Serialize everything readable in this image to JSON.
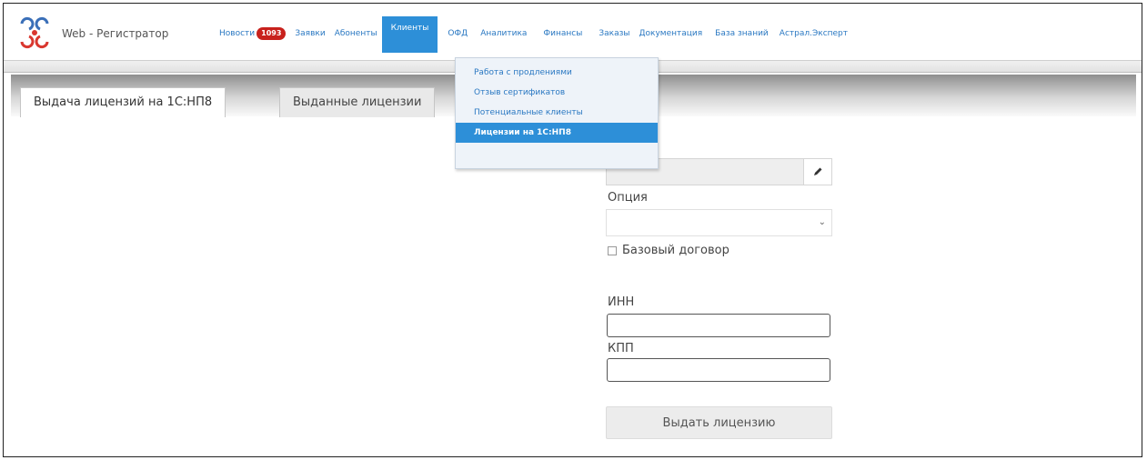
{
  "app": {
    "brand": "Web - Регистратор"
  },
  "nav": {
    "items": [
      {
        "label": "Новости",
        "badge": "1093"
      },
      {
        "label": "Заявки"
      },
      {
        "label": "Абоненты"
      },
      {
        "label": "Клиенты",
        "active": true
      },
      {
        "label": "ОФД"
      },
      {
        "label": "Аналитика"
      },
      {
        "label": "Финансы"
      },
      {
        "label": "Заказы"
      },
      {
        "label": "Документация"
      },
      {
        "label": "База знаний"
      },
      {
        "label": "Астрал.Эксперт"
      }
    ]
  },
  "dropdown": {
    "items": [
      "Работа с продлениями",
      "Отзыв сертификатов",
      "Потенциальные клиенты",
      "Лицензии на 1С:НП8"
    ],
    "selected_index": 3
  },
  "tabs": {
    "active": "Выдача лицензий на 1С:НП8",
    "inactive": "Выданные лицензии"
  },
  "form": {
    "option_label": "Опция",
    "option_value": "",
    "base_contract_label": "Базовый договор",
    "base_contract_checked": false,
    "inn_label": "ИНН",
    "inn_value": "",
    "kpp_label": "КПП",
    "kpp_value": "",
    "submit_label": "Выдать лицензию"
  },
  "colors": {
    "link": "#2a78c2",
    "active_nav": "#2d8fd8",
    "badge": "#c8211c"
  },
  "icons": {
    "logo": "swirl-logo-icon",
    "edit": "pencil-icon",
    "select_caret": "chevron-down-icon"
  }
}
